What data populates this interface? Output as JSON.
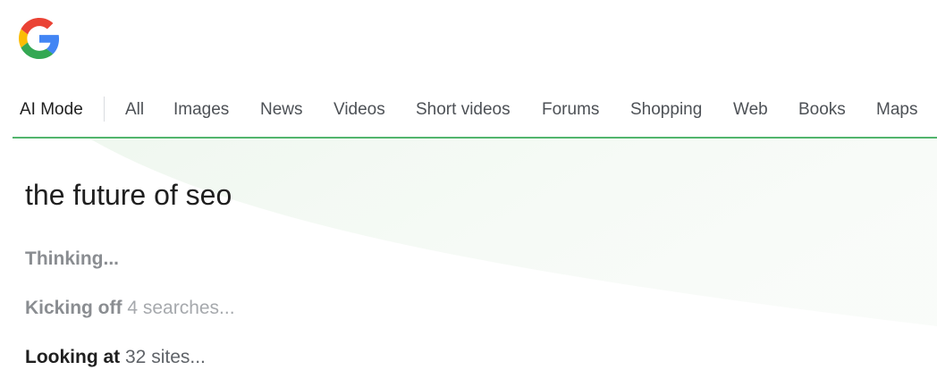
{
  "logo": {
    "icon": "google-g-icon",
    "colors": [
      "#4285F4",
      "#EA4335",
      "#FBBC05",
      "#34A853"
    ]
  },
  "tabs": [
    {
      "label": "AI Mode",
      "active": true
    },
    {
      "label": "All"
    },
    {
      "label": "Images"
    },
    {
      "label": "News"
    },
    {
      "label": "Videos"
    },
    {
      "label": "Short videos"
    },
    {
      "label": "Forums"
    },
    {
      "label": "Shopping"
    },
    {
      "label": "Web"
    },
    {
      "label": "Books"
    },
    {
      "label": "Maps"
    }
  ],
  "accent_color": "#34A853",
  "query": "the future of seo",
  "status": {
    "thinking": "Thinking...",
    "kicking_off": {
      "strong": "Kicking off",
      "rest": " 4 searches..."
    },
    "looking_at": {
      "strong": "Looking at",
      "rest": " 32 sites..."
    }
  }
}
